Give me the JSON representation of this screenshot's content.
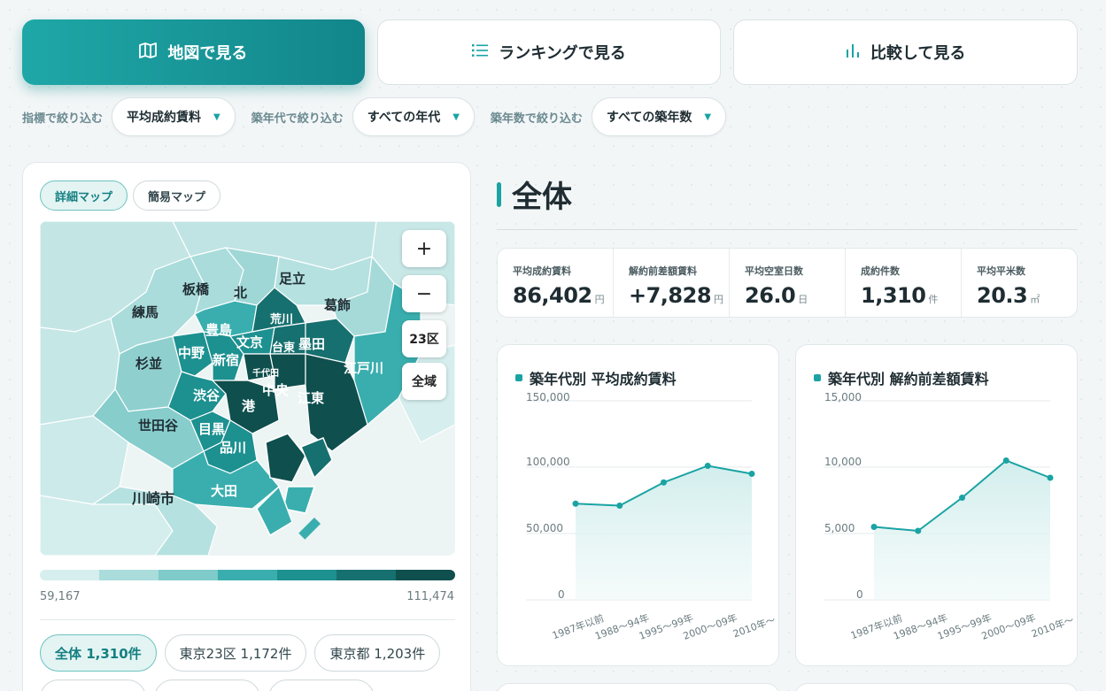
{
  "tabs": [
    {
      "label": "地図で見る",
      "icon": "map-icon",
      "active": true
    },
    {
      "label": "ランキングで見る",
      "icon": "list-icon",
      "active": false
    },
    {
      "label": "比較して見る",
      "icon": "bar-chart-icon",
      "active": false
    }
  ],
  "filters": {
    "indicator_label": "指標で絞り込む",
    "indicator_value": "平均成約賃料",
    "era_label": "築年代で絞り込む",
    "era_value": "すべての年代",
    "age_label": "築年数で絞り込む",
    "age_value": "すべての築年数"
  },
  "map_panel": {
    "toggle_detail": "詳細マップ",
    "toggle_simple": "簡易マップ",
    "zoom_in": "+",
    "zoom_out": "−",
    "btn_23ku": "23区",
    "btn_all": "全域",
    "wards": {
      "adachi": "足立",
      "itabashi": "板橋",
      "kita": "北",
      "katsushika": "葛飾",
      "nerima": "練馬",
      "arakawa": "荒川",
      "toshima": "豊島",
      "bunkyo": "文京",
      "taito": "台東",
      "sumida": "墨田",
      "suginami": "杉並",
      "nakano": "中野",
      "shinjuku": "新宿",
      "chiyoda": "千代田",
      "edogawa": "江戸川",
      "shibuya": "渋谷",
      "chuo": "中央",
      "koto": "江東",
      "minato": "港",
      "setagaya": "世田谷",
      "meguro": "目黒",
      "shinagawa": "品川",
      "ota": "大田",
      "kawasaki": "川崎市"
    },
    "legend_min": "59,167",
    "legend_max": "111,474",
    "legend_colors": [
      "#d6eeee",
      "#a9dcdb",
      "#7ecbca",
      "#3aaeae",
      "#1d9090",
      "#16706f",
      "#0f4f4e"
    ],
    "regions": [
      {
        "label": "全体 1,310件",
        "active": true
      },
      {
        "label": "東京23区 1,172件",
        "active": false
      },
      {
        "label": "東京都 1,203件",
        "active": false
      }
    ]
  },
  "summary": {
    "title": "全体",
    "stats": [
      {
        "label": "平均成約賃料",
        "value": "86,402",
        "unit": "円"
      },
      {
        "label": "解約前差額賃料",
        "value": "+7,828",
        "unit": "円"
      },
      {
        "label": "平均空室日数",
        "value": "26.0",
        "unit": "日"
      },
      {
        "label": "成約件数",
        "value": "1,310",
        "unit": "件"
      },
      {
        "label": "平均平米数",
        "value": "20.3",
        "unit": "㎡"
      }
    ]
  },
  "chart_data": [
    {
      "type": "line",
      "title": "築年代別 平均成約賃料",
      "categories": [
        "1987年以前",
        "1988〜94年",
        "1995〜99年",
        "2000〜09年",
        "2010年〜"
      ],
      "values": [
        72500,
        71000,
        88500,
        101000,
        95000
      ],
      "ylim": [
        0,
        150000
      ],
      "yticks": [
        "0",
        "50,000",
        "100,000",
        "150,000"
      ],
      "grid": true,
      "color": "#1aa3a3"
    },
    {
      "type": "line",
      "title": "築年代別 解約前差額賃料",
      "categories": [
        "1987年以前",
        "1988〜94年",
        "1995〜99年",
        "2000〜09年",
        "2010年〜"
      ],
      "values": [
        5500,
        5200,
        7700,
        10500,
        9200
      ],
      "ylim": [
        0,
        15000
      ],
      "yticks": [
        "0",
        "5,000",
        "10,000",
        "15,000"
      ],
      "grid": true,
      "color": "#1aa3a3"
    }
  ]
}
